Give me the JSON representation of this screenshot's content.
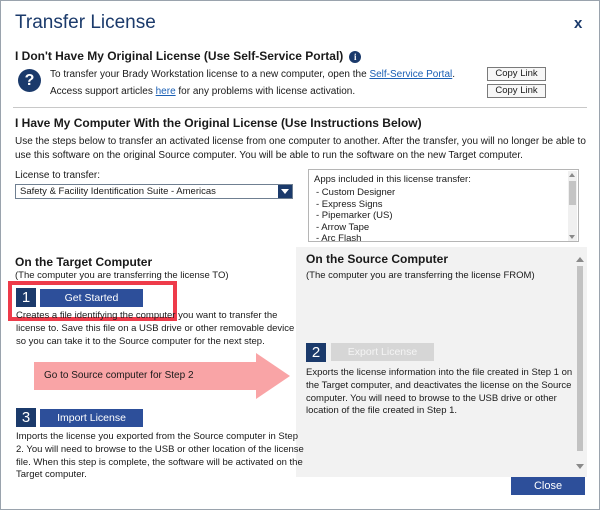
{
  "window": {
    "title": "Transfer License",
    "close_label": "x"
  },
  "self_service": {
    "heading": "I Don't Have My Original License (Use Self-Service Portal)",
    "line1_prefix": "To transfer your Brady Workstation license to a new computer, open the ",
    "line1_link": "Self-Service Portal",
    "line1_suffix": ".",
    "line2_prefix": "Access support articles ",
    "line2_link": "here",
    "line2_suffix": " for any problems with license activation.",
    "copy_link_1": "Copy Link",
    "copy_link_2": "Copy Link"
  },
  "instructions": {
    "heading": "I Have My Computer With the Original License (Use Instructions Below)",
    "paragraph": "Use the steps below to transfer an activated license from one computer to another. After the transfer, you will no longer be able to use this software on the original Source computer. You will be able to run the software on the new Target computer.",
    "license_label": "License to transfer:",
    "license_selected": "Safety & Facility Identification Suite - Americas",
    "apps_title": "Apps included in this license transfer:",
    "apps": [
      "- Custom Designer",
      "- Express Signs",
      "- Pipemarker (US)",
      "- Arrow Tape",
      "- Arc Flash"
    ]
  },
  "target": {
    "heading": "On the Target Computer",
    "subheading": "(The computer you are transferring the license TO)",
    "step1_num": "1",
    "step1_button": "Get Started",
    "step1_desc_l1": "Creates a file identifying the computer you want to transfer the",
    "step1_desc_l2": "license to. Save this file on a USB drive or other removable device",
    "step1_desc_l3": "so you can take it to the Source computer for the next step.",
    "arrow_text": "Go to Source computer for Step 2",
    "step3_num": "3",
    "step3_button": "Import License",
    "step3_desc_l1": "Imports the license you exported from the Source computer in Step",
    "step3_desc_l2": "2. You will need to browse to the USB or other location of the license",
    "step3_desc_l3": "file. When this step is complete, the software will be activated on the",
    "step3_desc_l4": "Target computer."
  },
  "source": {
    "heading": "On the Source Computer",
    "subheading": "(The computer you are transferring the license FROM)",
    "step2_num": "2",
    "step2_button": "Export License",
    "step2_desc_l1": "Exports the license information into the file created in Step 1 on",
    "step2_desc_l2": "the Target computer, and deactivates the license on the Source",
    "step2_desc_l3": "computer. You will need to browse to the USB drive or other",
    "step2_desc_l4": "location of the file created in Step 1."
  },
  "footer": {
    "close_button": "Close"
  },
  "colors": {
    "accent": "#1b3a6b",
    "button": "#2d4f9a",
    "highlight": "#ee3b4a",
    "arrow": "#f9a4a6"
  }
}
